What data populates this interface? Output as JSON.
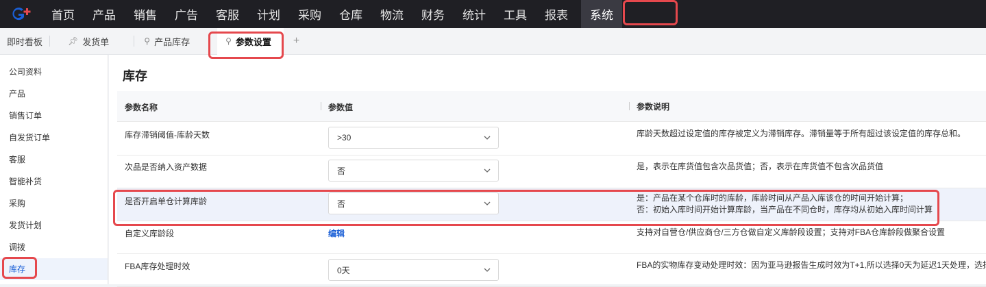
{
  "nav": {
    "items": [
      "首页",
      "产品",
      "销售",
      "广告",
      "客服",
      "计划",
      "采购",
      "仓库",
      "物流",
      "财务",
      "统计",
      "工具",
      "报表",
      "系统"
    ],
    "active": "系统",
    "brand_color": "#1a5fd6",
    "accent_color": "#e5484d"
  },
  "tabs": {
    "dashboard": "即时看板",
    "items": [
      "发货单",
      "产品库存",
      "参数设置"
    ],
    "active": "参数设置",
    "add": "+"
  },
  "sidebar": {
    "items": [
      "公司资料",
      "产品",
      "销售订单",
      "自发货订单",
      "客服",
      "智能补货",
      "采购",
      "发货计划",
      "调拨",
      "库存"
    ],
    "active": "库存"
  },
  "main": {
    "title": "库存",
    "columns": [
      "参数名称",
      "参数值",
      "参数说明"
    ],
    "rows": [
      {
        "name": "库存滞销阈值-库龄天数",
        "value": ">30",
        "desc1": "库龄天数超过设定值的库存被定义为滞销库存。滞销量等于所有超过该设定值的库存总和。",
        "desc2": ""
      },
      {
        "name": "次品是否纳入资产数据",
        "value": "否",
        "desc1": "是，表示在库货值包含次品货值；否，表示在库货值不包含次品货值",
        "desc2": ""
      },
      {
        "name": "是否开启单仓计算库龄",
        "value": "否",
        "desc1": "是：产品在某个仓库时的库龄，库龄时间从产品入库该仓的时间开始计算；",
        "desc2": "否：初始入库时间开始计算库龄，当产品在不同仓时，库存均从初始入库时间计算"
      },
      {
        "name": "自定义库龄段",
        "value": "编辑",
        "desc1": "支持对自营仓/供应商仓/三方仓做自定义库龄段设置；支持对FBA仓库龄段做聚合设置",
        "desc2": ""
      },
      {
        "name": "FBA库存处理时效",
        "value": "0天",
        "desc1": "FBA的实物库存变动处理时效：因为亚马逊报告生成时效为T+1,所以选择0天为延迟1天处理，选择",
        "desc2": ""
      }
    ]
  }
}
